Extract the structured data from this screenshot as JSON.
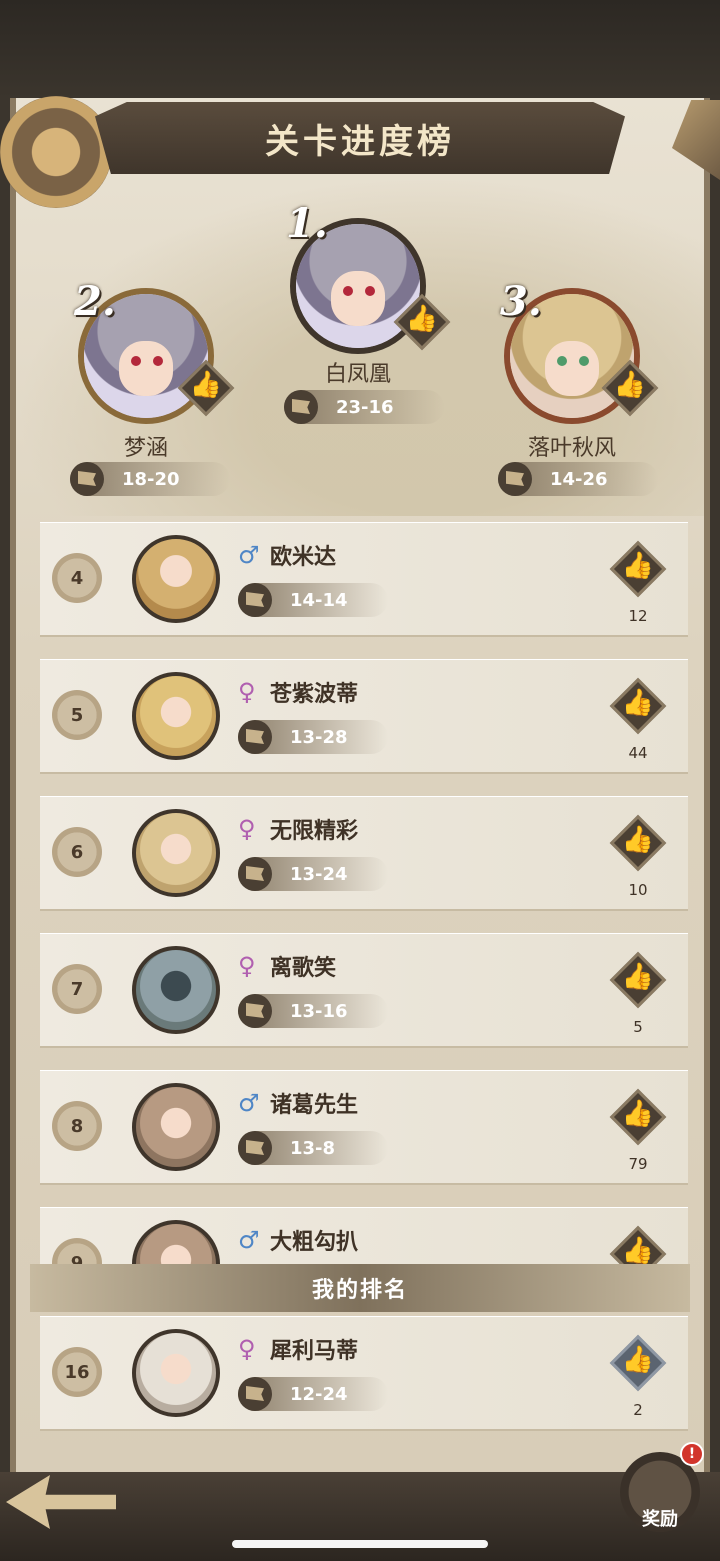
{
  "title": "关卡进度榜",
  "podium": [
    {
      "rank": "1.",
      "name": "白凤凰",
      "progress": "23-16",
      "hair": "#a6a1b0"
    },
    {
      "rank": "2.",
      "name": "梦涵",
      "progress": "18-20",
      "hair": "#a6a1b0"
    },
    {
      "rank": "3.",
      "name": "落叶秋风",
      "progress": "14-26",
      "hair": "#dcc592"
    }
  ],
  "rows": [
    {
      "rank": "4",
      "gender": "♂",
      "gender_color": "#4f86c6",
      "name": "欧米达",
      "progress": "14-14",
      "likes": "12",
      "hair": "#d4b070"
    },
    {
      "rank": "5",
      "gender": "♀",
      "gender_color": "#b05fb0",
      "name": "苍紫波蒂",
      "progress": "13-28",
      "likes": "44",
      "hair": "#e0c27a"
    },
    {
      "rank": "6",
      "gender": "♀",
      "gender_color": "#b05fb0",
      "name": "无限精彩",
      "progress": "13-24",
      "likes": "10",
      "hair": "#dcc592"
    },
    {
      "rank": "7",
      "gender": "♀",
      "gender_color": "#b05fb0",
      "name": "离歌笑",
      "progress": "13-16",
      "likes": "5",
      "hair": "#8fa0a6"
    },
    {
      "rank": "8",
      "gender": "♂",
      "gender_color": "#4f86c6",
      "name": "诸葛先生",
      "progress": "13-8",
      "likes": "79",
      "hair": "#b79a82"
    },
    {
      "rank": "9",
      "gender": "♂",
      "gender_color": "#4f86c6",
      "name": "大粗勾扒",
      "progress": "",
      "likes": "",
      "hair": "#b79a82"
    }
  ],
  "my_rank_label": "我的排名",
  "my_rank": {
    "rank": "16",
    "gender": "♀",
    "gender_color": "#b05fb0",
    "name": "犀利马蒂",
    "progress": "12-24",
    "likes": "2",
    "hair": "#e6e0d6"
  },
  "reward_label": "奖励",
  "reward_badge": "!",
  "like_icon": "👍"
}
